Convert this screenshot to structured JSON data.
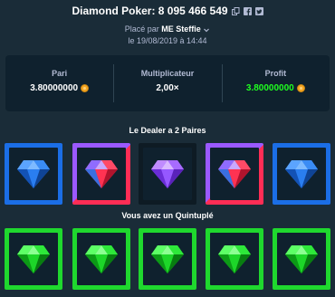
{
  "header": {
    "title": "Diamond Poker: 8 095 466 549"
  },
  "bet_info": {
    "placed_by_prefix": "Placé par",
    "username": "ME Steffie",
    "date": "le 19/08/2019 à 14:44"
  },
  "stats": {
    "bet_label": "Pari",
    "bet_value": "3.80000000",
    "multiplier_label": "Multiplicateur",
    "multiplier_value": "2,00×",
    "profit_label": "Profit",
    "profit_value": "3.80000000"
  },
  "dealer": {
    "title": "Le Dealer a 2 Paires",
    "gems": [
      "blue",
      "red",
      "purple",
      "red",
      "blue"
    ]
  },
  "player": {
    "title": "Vous avez un Quintuplé",
    "gems": [
      "green",
      "green",
      "green",
      "green",
      "green"
    ]
  },
  "colors": {
    "background": "#1a2c38",
    "panel": "#0f212e",
    "profit": "#1fff20",
    "blue_frame": "#1b6ee6",
    "pair_frame_purple": "#9b59ff",
    "pair_frame_red": "#ff2d55",
    "green_frame": "#1fd82e"
  }
}
